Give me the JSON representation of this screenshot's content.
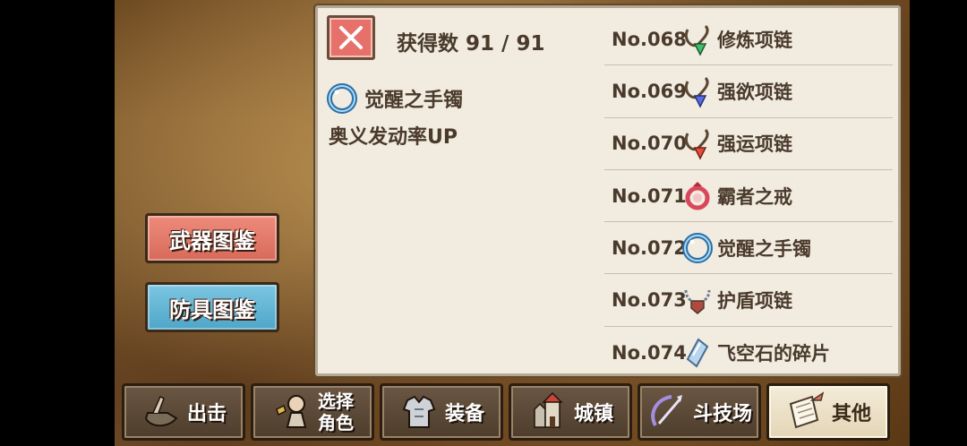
{
  "header": {
    "count_label": "获得数",
    "count_value": "91 / 91"
  },
  "side": {
    "weapon_label": "武器图鉴",
    "armor_label": "防具图鉴"
  },
  "detail": {
    "name": "觉醒之手镯",
    "icon": "bracelet-icon",
    "description": "奥义发动率UP"
  },
  "items": [
    {
      "no": "No.068",
      "name": "修炼项链",
      "icon": "necklace-green-icon"
    },
    {
      "no": "No.069",
      "name": "强欲项链",
      "icon": "necklace-blue-icon"
    },
    {
      "no": "No.070",
      "name": "强运项链",
      "icon": "necklace-red-icon"
    },
    {
      "no": "No.071",
      "name": "霸者之戒",
      "icon": "ring-icon"
    },
    {
      "no": "No.072",
      "name": "觉醒之手镯",
      "icon": "bracelet-icon"
    },
    {
      "no": "No.073",
      "name": "护盾项链",
      "icon": "shield-necklace-icon"
    },
    {
      "no": "No.074",
      "name": "飞空石的碎片",
      "icon": "crystal-shard-icon"
    }
  ],
  "nav": [
    {
      "label": "出击",
      "icon": "sortie-icon"
    },
    {
      "label_top": "选择",
      "label_bottom": "角色",
      "icon": "character-icon"
    },
    {
      "label": "装备",
      "icon": "armor-icon"
    },
    {
      "label": "城镇",
      "icon": "castle-icon"
    },
    {
      "label": "斗技场",
      "icon": "arena-icon"
    },
    {
      "label": "其他",
      "icon": "scroll-icon",
      "active": true
    }
  ],
  "colors": {
    "close_button": "#e5716a",
    "weapon_button": "#e57c6c",
    "armor_button": "#5fb3d4",
    "panel": "#f1ebe0"
  }
}
